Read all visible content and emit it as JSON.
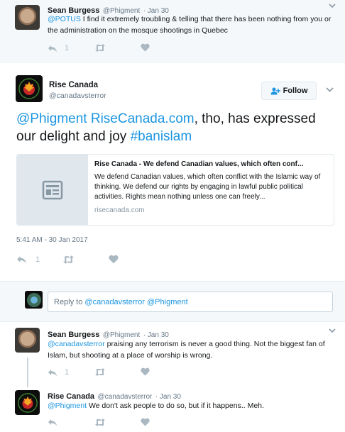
{
  "tweet1": {
    "name": "Sean Burgess",
    "handle": "@Phigment",
    "time": "· Jan 30",
    "mention": "@POTUS",
    "text": " I find it extremely troubling & telling that there has been nothing from you or the administration on the mosque shootings in Quebec",
    "reply_count": "1"
  },
  "main": {
    "name": "Rise Canada",
    "handle": "@canadavsterror",
    "follow_label": "Follow",
    "text_mention": "@Phigment",
    "text_link": "RiseCanada.com",
    "text_middle": ", tho, has expressed our delight and joy ",
    "text_hashtag": "#banislam",
    "card": {
      "title": "Rise Canada - We defend Canadian values, which often conf...",
      "description": "We defend Canadian values, which often conflict with the Islamic way of thinking. We defend our rights by engaging in lawful public political activities. Rights mean nothing unless one can freely...",
      "domain": "risecanada.com"
    },
    "timestamp": "5:41 AM - 30 Jan 2017",
    "reply_count": "1"
  },
  "reply_box": {
    "prefix": "Reply to ",
    "mentions": "@canadavsterror @Phigment"
  },
  "tweet2": {
    "name": "Sean Burgess",
    "handle": "@Phigment",
    "time": "· Jan 30",
    "mention": "@canadavsterror",
    "text": " praising any terrorism is never a good thing. Not the biggest fan of Islam, but shooting at a place of worship is wrong.",
    "reply_count": "1"
  },
  "tweet3": {
    "name": "Rise Canada",
    "handle": "@canadavsterror",
    "time": "· Jan 30",
    "mention": "@Phigment",
    "text": " We don't ask people to do so, but if it happens.. Meh."
  },
  "colors": {
    "link": "#1b95e0",
    "background_grey": "#f5f8fa",
    "icon_grey": "#aab8c2"
  }
}
